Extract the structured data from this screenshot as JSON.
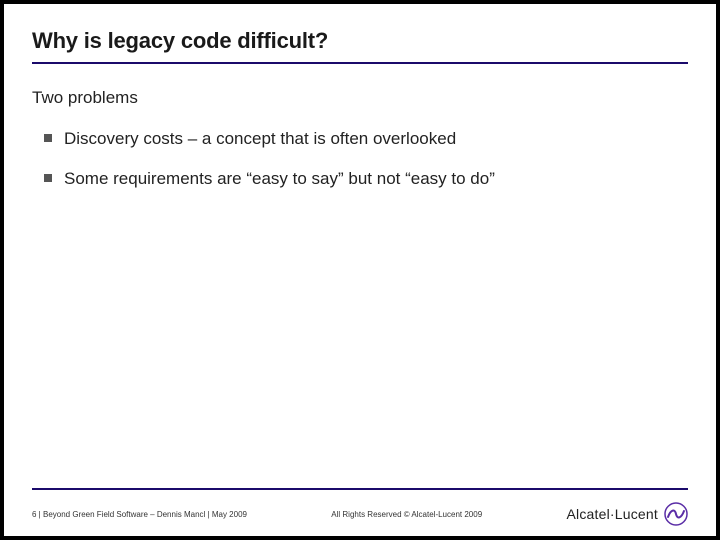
{
  "slide": {
    "title": "Why is legacy code difficult?",
    "lead": "Two problems",
    "bullets": [
      "Discovery costs – a concept that is often overlooked",
      "Some requirements are “easy to say” but not “easy to do”"
    ]
  },
  "footer": {
    "page_number": "6",
    "sep1": " | ",
    "doc_title": "Beyond Green Field Software – Dennis Mancl",
    "sep2": " | ",
    "date": "May 2009",
    "copyright": "All Rights Reserved © Alcatel-Lucent 2009",
    "brand_name": "Alcatel·Lucent"
  },
  "colors": {
    "accent": "#1b0a6b",
    "brand_purple": "#5a2da6"
  }
}
